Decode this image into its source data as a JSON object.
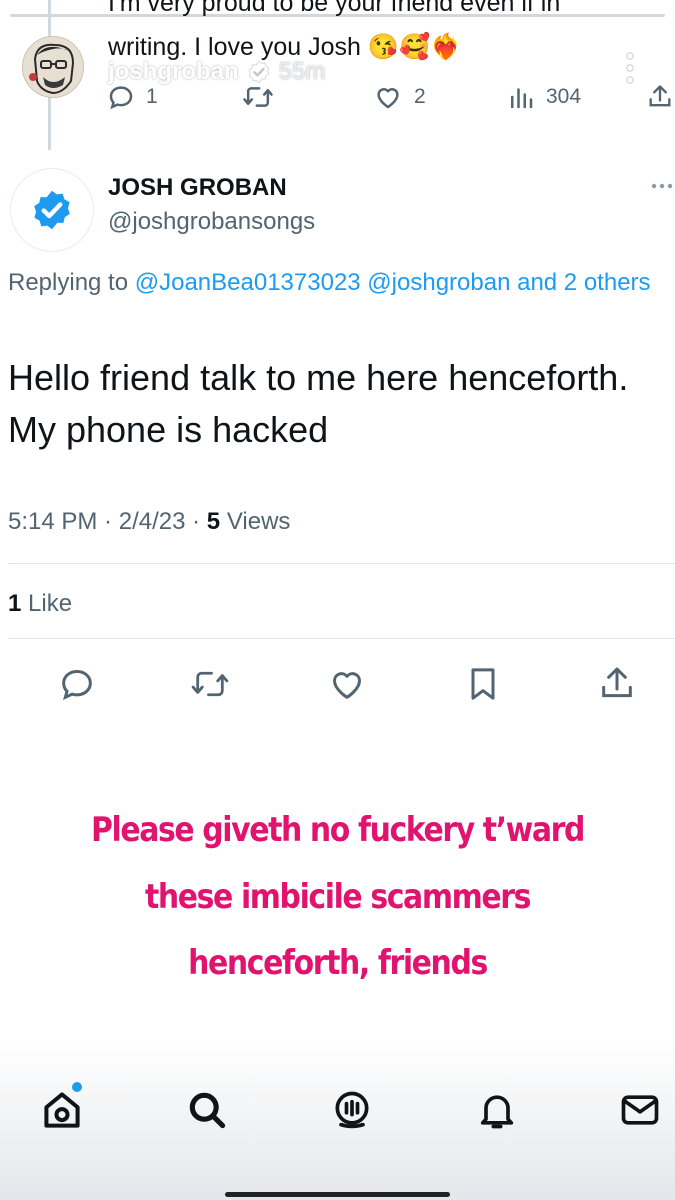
{
  "story": {
    "username": "joshgroban",
    "time": "55m",
    "caption_lines": [
      "Please giveth no fuckery t’ward",
      "these imbicile scammers",
      "henceforth, friends"
    ]
  },
  "previous_tweet": {
    "text_line1": "I'm very proud to be your friend even if in",
    "text_line2": "writing. I love you Josh 😘🥰❤️‍🔥",
    "reply_count": "1",
    "like_count": "2",
    "view_count": "304"
  },
  "tweet": {
    "name": "JOSH GROBAN",
    "handle": "@joshgrobansongs",
    "replying_prefix": "Replying to ",
    "replying_handles": "@JoanBea01373023 @joshgroban and 2 others",
    "text": "Hello friend talk to me here henceforth. My phone is hacked",
    "time": "5:14 PM",
    "date": "2/4/23",
    "views_count": "5",
    "views_label": "Views",
    "likes_count": "1",
    "likes_label": "Like"
  },
  "icons": {
    "tweet_actions": [
      "reply-icon",
      "retweet-icon",
      "like-icon",
      "bookmark-icon",
      "share-icon"
    ],
    "bottom_nav": [
      "home-icon",
      "search-icon",
      "spaces-icon",
      "notifications-icon",
      "messages-icon"
    ]
  },
  "colors": {
    "accent": "#1d9bf0",
    "caption": "#e0146f",
    "text": "#0f1419",
    "muted": "#536471"
  }
}
